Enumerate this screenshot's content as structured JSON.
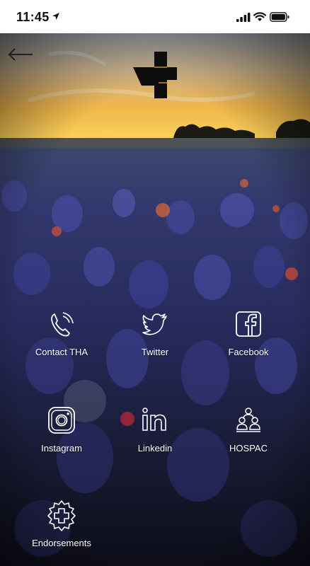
{
  "status_bar": {
    "time": "11:45"
  },
  "tiles": [
    {
      "label": "Contact THA",
      "icon": "phone-icon"
    },
    {
      "label": "Twitter",
      "icon": "twitter-icon"
    },
    {
      "label": "Facebook",
      "icon": "facebook-icon"
    },
    {
      "label": "Instagram",
      "icon": "instagram-icon"
    },
    {
      "label": "Linkedin",
      "icon": "linkedin-icon"
    },
    {
      "label": "HOSPAC",
      "icon": "people-icon"
    },
    {
      "label": "Endorsements",
      "icon": "medical-badge-icon"
    }
  ]
}
